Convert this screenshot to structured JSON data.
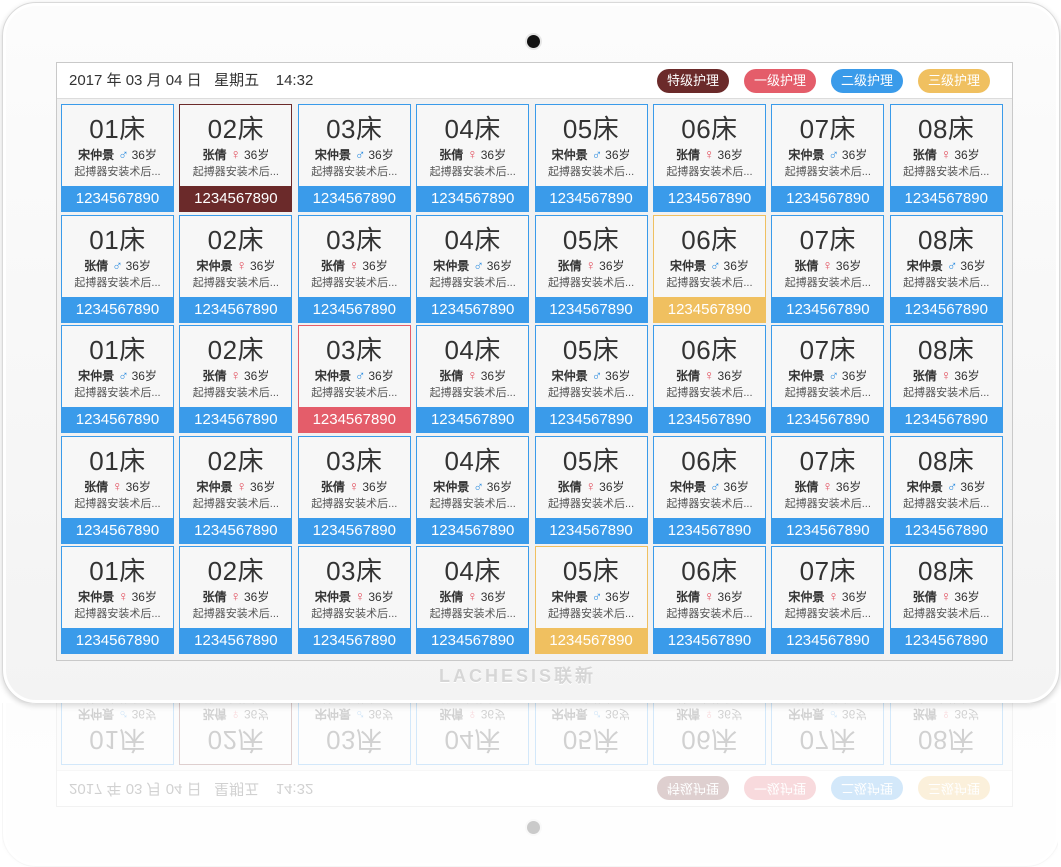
{
  "header": {
    "datetime": "2017 年 03 月 04 日   星期五    14:32"
  },
  "legend": [
    {
      "label": "特级护理",
      "color": "#6b2a2a"
    },
    {
      "label": "一级护理",
      "color": "#e45d6a"
    },
    {
      "label": "二级护理",
      "color": "#3a9bea"
    },
    {
      "label": "三级护理",
      "color": "#f0c060"
    }
  ],
  "colors": {
    "default": "#3a9bea",
    "special": "#6b2a2a",
    "level1": "#e45d6a",
    "level3": "#f0c060"
  },
  "brand": "LACHESIS联新",
  "beds": [
    [
      {
        "bed": "01床",
        "name": "宋仲景",
        "gender": "male",
        "age": "36岁",
        "diag": "起搏器安装术后...",
        "phone": "1234567890",
        "level": "default"
      },
      {
        "bed": "02床",
        "name": "张倩",
        "gender": "female",
        "age": "36岁",
        "diag": "起搏器安装术后...",
        "phone": "1234567890",
        "level": "special"
      },
      {
        "bed": "03床",
        "name": "宋仲景",
        "gender": "male",
        "age": "36岁",
        "diag": "起搏器安装术后...",
        "phone": "1234567890",
        "level": "default"
      },
      {
        "bed": "04床",
        "name": "张倩",
        "gender": "female",
        "age": "36岁",
        "diag": "起搏器安装术后...",
        "phone": "1234567890",
        "level": "default"
      },
      {
        "bed": "05床",
        "name": "宋仲景",
        "gender": "male",
        "age": "36岁",
        "diag": "起搏器安装术后...",
        "phone": "1234567890",
        "level": "default"
      },
      {
        "bed": "06床",
        "name": "张倩",
        "gender": "female",
        "age": "36岁",
        "diag": "起搏器安装术后...",
        "phone": "1234567890",
        "level": "default"
      },
      {
        "bed": "07床",
        "name": "宋仲景",
        "gender": "male",
        "age": "36岁",
        "diag": "起搏器安装术后...",
        "phone": "1234567890",
        "level": "default"
      },
      {
        "bed": "08床",
        "name": "张倩",
        "gender": "female",
        "age": "36岁",
        "diag": "起搏器安装术后...",
        "phone": "1234567890",
        "level": "default"
      }
    ],
    [
      {
        "bed": "01床",
        "name": "张倩",
        "gender": "male",
        "age": "36岁",
        "diag": "起搏器安装术后...",
        "phone": "1234567890",
        "level": "default"
      },
      {
        "bed": "02床",
        "name": "宋仲景",
        "gender": "female",
        "age": "36岁",
        "diag": "起搏器安装术后...",
        "phone": "1234567890",
        "level": "default"
      },
      {
        "bed": "03床",
        "name": "张倩",
        "gender": "female",
        "age": "36岁",
        "diag": "起搏器安装术后...",
        "phone": "1234567890",
        "level": "default"
      },
      {
        "bed": "04床",
        "name": "宋仲景",
        "gender": "male",
        "age": "36岁",
        "diag": "起搏器安装术后...",
        "phone": "1234567890",
        "level": "default"
      },
      {
        "bed": "05床",
        "name": "张倩",
        "gender": "female",
        "age": "36岁",
        "diag": "起搏器安装术后...",
        "phone": "1234567890",
        "level": "default"
      },
      {
        "bed": "06床",
        "name": "宋仲景",
        "gender": "male",
        "age": "36岁",
        "diag": "起搏器安装术后...",
        "phone": "1234567890",
        "level": "level3"
      },
      {
        "bed": "07床",
        "name": "张倩",
        "gender": "female",
        "age": "36岁",
        "diag": "起搏器安装术后...",
        "phone": "1234567890",
        "level": "default"
      },
      {
        "bed": "08床",
        "name": "宋仲景",
        "gender": "male",
        "age": "36岁",
        "diag": "起搏器安装术后...",
        "phone": "1234567890",
        "level": "default"
      }
    ],
    [
      {
        "bed": "01床",
        "name": "宋仲景",
        "gender": "male",
        "age": "36岁",
        "diag": "起搏器安装术后...",
        "phone": "1234567890",
        "level": "default"
      },
      {
        "bed": "02床",
        "name": "张倩",
        "gender": "female",
        "age": "36岁",
        "diag": "起搏器安装术后...",
        "phone": "1234567890",
        "level": "default"
      },
      {
        "bed": "03床",
        "name": "宋仲景",
        "gender": "male",
        "age": "36岁",
        "diag": "起搏器安装术后...",
        "phone": "1234567890",
        "level": "level1"
      },
      {
        "bed": "04床",
        "name": "张倩",
        "gender": "female",
        "age": "36岁",
        "diag": "起搏器安装术后...",
        "phone": "1234567890",
        "level": "default"
      },
      {
        "bed": "05床",
        "name": "宋仲景",
        "gender": "male",
        "age": "36岁",
        "diag": "起搏器安装术后...",
        "phone": "1234567890",
        "level": "default"
      },
      {
        "bed": "06床",
        "name": "张倩",
        "gender": "female",
        "age": "36岁",
        "diag": "起搏器安装术后...",
        "phone": "1234567890",
        "level": "default"
      },
      {
        "bed": "07床",
        "name": "宋仲景",
        "gender": "male",
        "age": "36岁",
        "diag": "起搏器安装术后...",
        "phone": "1234567890",
        "level": "default"
      },
      {
        "bed": "08床",
        "name": "张倩",
        "gender": "female",
        "age": "36岁",
        "diag": "起搏器安装术后...",
        "phone": "1234567890",
        "level": "default"
      }
    ],
    [
      {
        "bed": "01床",
        "name": "张倩",
        "gender": "female",
        "age": "36岁",
        "diag": "起搏器安装术后...",
        "phone": "1234567890",
        "level": "default"
      },
      {
        "bed": "02床",
        "name": "宋仲景",
        "gender": "female",
        "age": "36岁",
        "diag": "起搏器安装术后...",
        "phone": "1234567890",
        "level": "default"
      },
      {
        "bed": "03床",
        "name": "张倩",
        "gender": "female",
        "age": "36岁",
        "diag": "起搏器安装术后...",
        "phone": "1234567890",
        "level": "default"
      },
      {
        "bed": "04床",
        "name": "宋仲景",
        "gender": "male",
        "age": "36岁",
        "diag": "起搏器安装术后...",
        "phone": "1234567890",
        "level": "default"
      },
      {
        "bed": "05床",
        "name": "张倩",
        "gender": "female",
        "age": "36岁",
        "diag": "起搏器安装术后...",
        "phone": "1234567890",
        "level": "default"
      },
      {
        "bed": "06床",
        "name": "宋仲景",
        "gender": "male",
        "age": "36岁",
        "diag": "起搏器安装术后...",
        "phone": "1234567890",
        "level": "default"
      },
      {
        "bed": "07床",
        "name": "张倩",
        "gender": "female",
        "age": "36岁",
        "diag": "起搏器安装术后...",
        "phone": "1234567890",
        "level": "default"
      },
      {
        "bed": "08床",
        "name": "宋仲景",
        "gender": "male",
        "age": "36岁",
        "diag": "起搏器安装术后...",
        "phone": "1234567890",
        "level": "default"
      }
    ],
    [
      {
        "bed": "01床",
        "name": "宋仲景",
        "gender": "female",
        "age": "36岁",
        "diag": "起搏器安装术后...",
        "phone": "1234567890",
        "level": "default"
      },
      {
        "bed": "02床",
        "name": "张倩",
        "gender": "female",
        "age": "36岁",
        "diag": "起搏器安装术后...",
        "phone": "1234567890",
        "level": "default"
      },
      {
        "bed": "03床",
        "name": "宋仲景",
        "gender": "female",
        "age": "36岁",
        "diag": "起搏器安装术后...",
        "phone": "1234567890",
        "level": "default"
      },
      {
        "bed": "04床",
        "name": "张倩",
        "gender": "female",
        "age": "36岁",
        "diag": "起搏器安装术后...",
        "phone": "1234567890",
        "level": "default"
      },
      {
        "bed": "05床",
        "name": "宋仲景",
        "gender": "male",
        "age": "36岁",
        "diag": "起搏器安装术后...",
        "phone": "1234567890",
        "level": "level3"
      },
      {
        "bed": "06床",
        "name": "张倩",
        "gender": "female",
        "age": "36岁",
        "diag": "起搏器安装术后...",
        "phone": "1234567890",
        "level": "default"
      },
      {
        "bed": "07床",
        "name": "宋仲景",
        "gender": "female",
        "age": "36岁",
        "diag": "起搏器安装术后...",
        "phone": "1234567890",
        "level": "default"
      },
      {
        "bed": "08床",
        "name": "张倩",
        "gender": "female",
        "age": "36岁",
        "diag": "起搏器安装术后...",
        "phone": "1234567890",
        "level": "default"
      }
    ]
  ]
}
